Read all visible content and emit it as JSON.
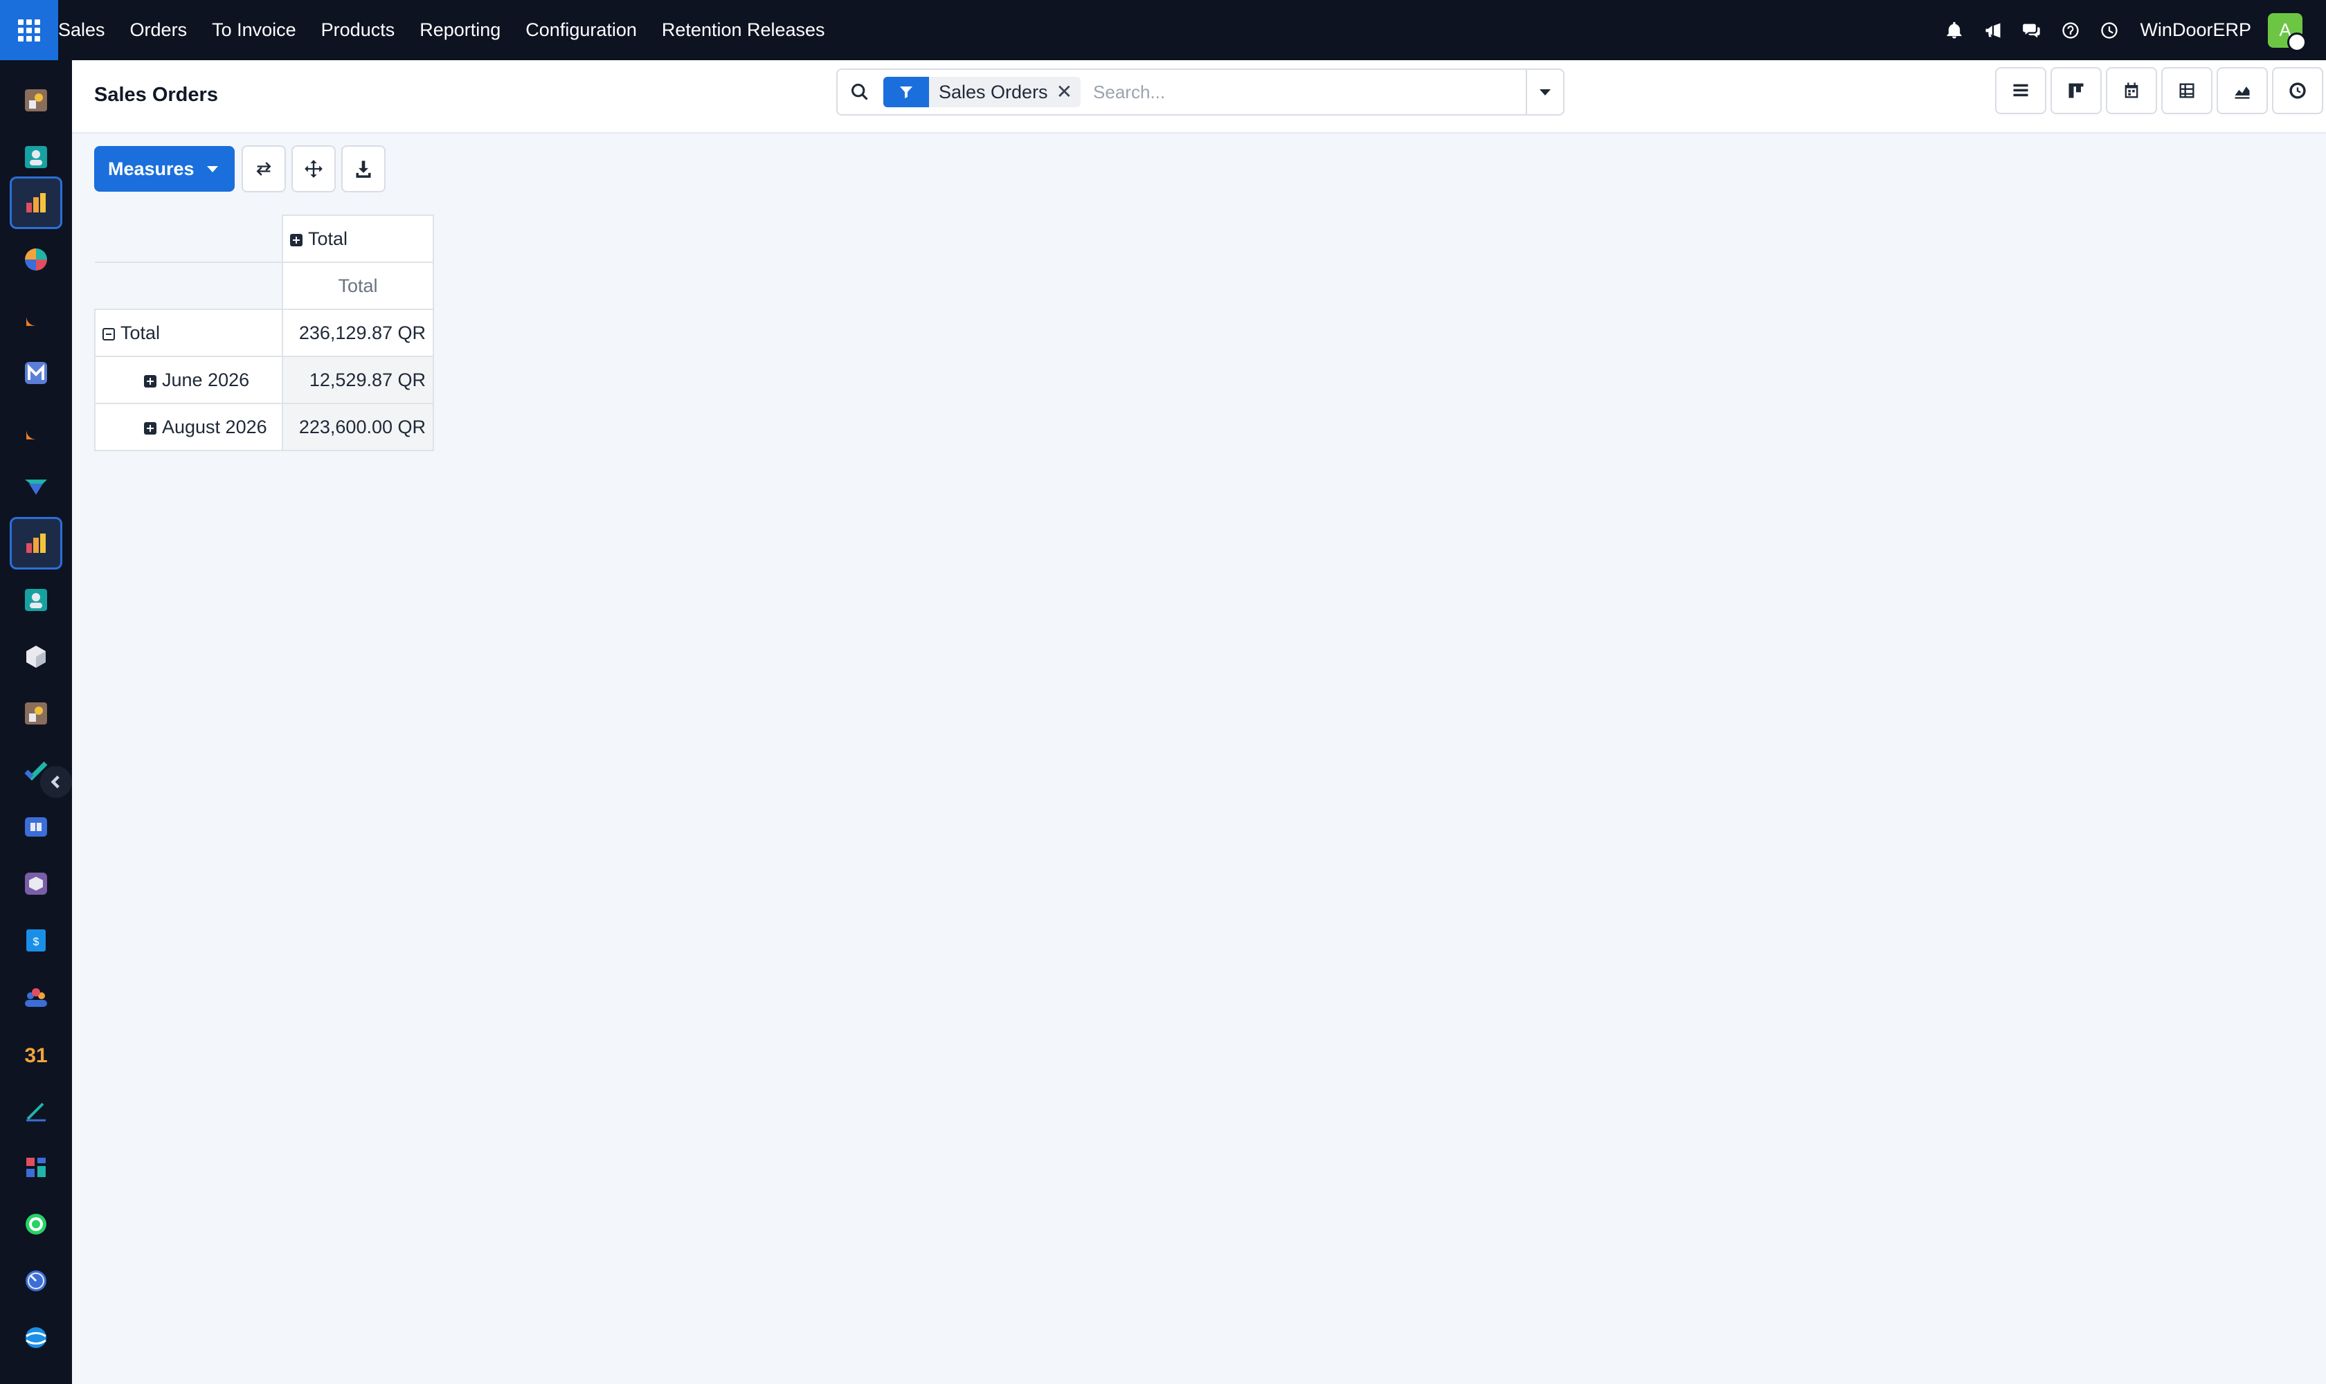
{
  "topbar": {
    "menu": [
      "Sales",
      "Orders",
      "To Invoice",
      "Products",
      "Reporting",
      "Configuration",
      "Retention Releases"
    ],
    "company": "WinDoorERP",
    "user_initial": "A",
    "icons": [
      "bell-icon",
      "megaphone-icon",
      "chat-icon",
      "help-icon",
      "clock-icon"
    ],
    "colors": {
      "bar": "#0d1321",
      "apps_button": "#1a6fdc",
      "avatar": "#6cc644"
    }
  },
  "sidebar": {
    "items": [
      "dashboard-app-icon",
      "contacts-app-icon",
      "sales-app-icon",
      "discuss-app-icon",
      "chat-app-icon",
      "mail-app-icon",
      "livechat-app-icon",
      "marketing-app-icon",
      "sales-reporting-app-icon",
      "employees-app-icon",
      "inventory-app-icon",
      "pos-app-icon",
      "tasks-app-icon",
      "knowledge-app-icon",
      "purchase-app-icon",
      "invoicing-app-icon",
      "team-app-icon",
      "calendar-app-icon",
      "sign-app-icon",
      "dashboards-app-icon",
      "whatsapp-app-icon",
      "timer-app-icon",
      "website-app-icon"
    ],
    "active": [
      "sales-app-icon",
      "sales-reporting-app-icon"
    ],
    "calendar_glyph": "31"
  },
  "control": {
    "breadcrumb": "Sales Orders",
    "search": {
      "facet_value": "Sales Orders",
      "facet_remove": "✕",
      "placeholder": "Search..."
    },
    "views": [
      "list-view-icon",
      "kanban-view-icon",
      "calendar-view-icon",
      "pivot-view-icon",
      "graph-view-icon",
      "activity-view-icon"
    ]
  },
  "pivot_buttons": {
    "measures_label": "Measures",
    "tools": [
      "flip-axis-icon",
      "expand-all-icon",
      "download-icon"
    ]
  },
  "pivot": {
    "col_header": "Total",
    "measure_header": "Total",
    "total_row": {
      "label": "Total",
      "value": "236,129.87 QR"
    },
    "rows": [
      {
        "label": "June 2026",
        "value": "12,529.87 QR"
      },
      {
        "label": "August 2026",
        "value": "223,600.00 QR"
      }
    ]
  }
}
